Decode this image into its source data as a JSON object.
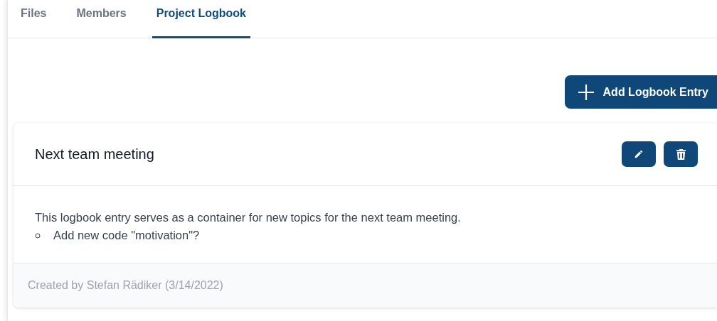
{
  "tabs": [
    {
      "label": "Files",
      "selected": false
    },
    {
      "label": "Members",
      "selected": false
    },
    {
      "label": "Project Logbook",
      "selected": true
    }
  ],
  "add_button": {
    "label": "Add Logbook Entry"
  },
  "entry": {
    "title": "Next team meeting",
    "text": "This logbook entry serves as a container for new topics for the next team meeting.",
    "list_items": [
      "Add new code \"motivation\"?"
    ],
    "footer": "Created by Stefan Rädiker (3/14/2022)"
  }
}
